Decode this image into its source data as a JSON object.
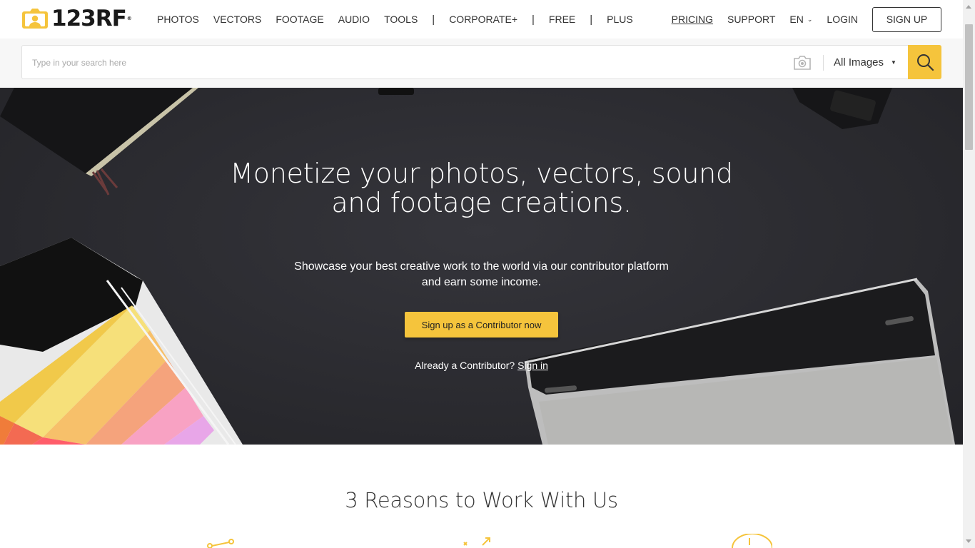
{
  "brand": {
    "name": "123RF",
    "tm": "®",
    "accent": "#f5c43c"
  },
  "nav": {
    "left": [
      "PHOTOS",
      "VECTORS",
      "FOOTAGE",
      "AUDIO",
      "TOOLS"
    ],
    "sep": "|",
    "corporate": "CORPORATE+",
    "free": "FREE",
    "plus": "PLUS",
    "pricing": "PRICING",
    "support": "SUPPORT",
    "lang": "EN",
    "login": "LOGIN",
    "signup": "SIGN UP"
  },
  "search": {
    "placeholder": "Type in your search here",
    "filter": "All Images"
  },
  "hero": {
    "title_line1": "Monetize your photos, vectors, sound",
    "title_line2": "and footage creations.",
    "sub_line1": "Showcase your best creative work to the world via our contributor platform",
    "sub_line2": "and earn some income.",
    "cta": "Sign up as a Contributor now",
    "already": "Already a Contributor?",
    "signin": "Sign in"
  },
  "reasons": {
    "title": "3 Reasons to Work With Us"
  },
  "icons": [
    "logo-camera-icon",
    "chevron-down-icon",
    "camera-icon",
    "caret-down-icon",
    "search-icon"
  ]
}
